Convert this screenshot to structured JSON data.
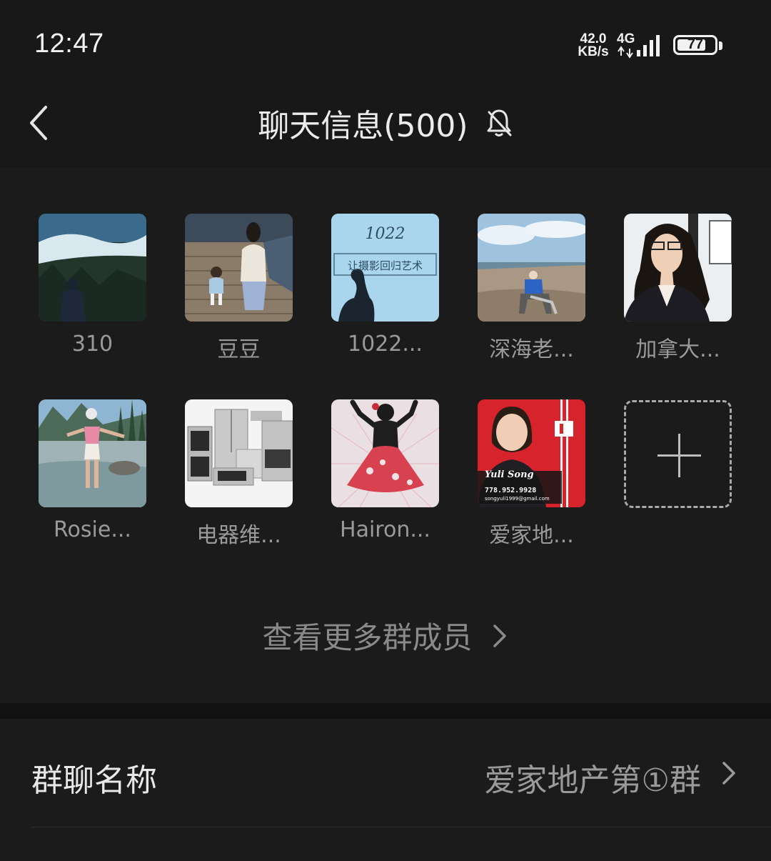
{
  "status_bar": {
    "time": "12:47",
    "net_speed_value": "42.0",
    "net_speed_unit": "KB/s",
    "net_type": "4G",
    "battery": "77",
    "battery_level_percent": 77
  },
  "header": {
    "title": "聊天信息(500)",
    "mute_icon": "bell-off-icon",
    "back_icon": "chevron-left-icon"
  },
  "members": [
    {
      "name": "310"
    },
    {
      "name": "豆豆"
    },
    {
      "name": "1022..."
    },
    {
      "name": "深海老..."
    },
    {
      "name": "加拿大..."
    },
    {
      "name": "Rosie..."
    },
    {
      "name": "电器维..."
    },
    {
      "name": "Hairon..."
    },
    {
      "name": "爱家地..."
    }
  ],
  "avatar_text": {
    "a1022_line1": "1022",
    "a1022_line2": "让摄影回归艺术",
    "ad_name": "Yuli Song",
    "ad_phone": "778.952.9928",
    "ad_email": "songyuli1999@gmail.com"
  },
  "add_member_icon": "plus-icon",
  "view_more": {
    "label": "查看更多群成员",
    "icon": "chevron-right-icon"
  },
  "group_name_row": {
    "label": "群聊名称",
    "value": "爱家地产第①群",
    "icon": "chevron-right-icon"
  },
  "colors": {
    "background": "#1b1b1b",
    "bar": "#181818",
    "text_primary": "#e8e8e8",
    "text_secondary": "#9a9a9a"
  }
}
